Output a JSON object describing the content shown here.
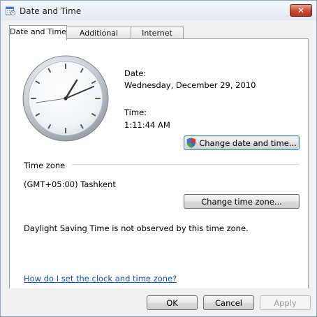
{
  "window": {
    "title": "Date and Time",
    "close_label": "✕"
  },
  "tabs": [
    {
      "label": "Date and Time",
      "active": true
    },
    {
      "label": "Additional Clocks",
      "active": false
    },
    {
      "label": "Internet Time",
      "active": false
    }
  ],
  "date_section": {
    "date_label": "Date:",
    "date_value": "Wednesday, December 29, 2010",
    "time_label": "Time:",
    "time_value": "1:11:44 AM",
    "change_button": "Change date and time..."
  },
  "timezone_section": {
    "heading": "Time zone",
    "value": "(GMT+05:00) Tashkent",
    "change_button": "Change time zone...",
    "dst_note": "Daylight Saving Time is not observed by this time zone."
  },
  "help_link": "How do I set the clock and time zone?",
  "footer": {
    "ok": "OK",
    "cancel": "Cancel",
    "apply": "Apply"
  }
}
